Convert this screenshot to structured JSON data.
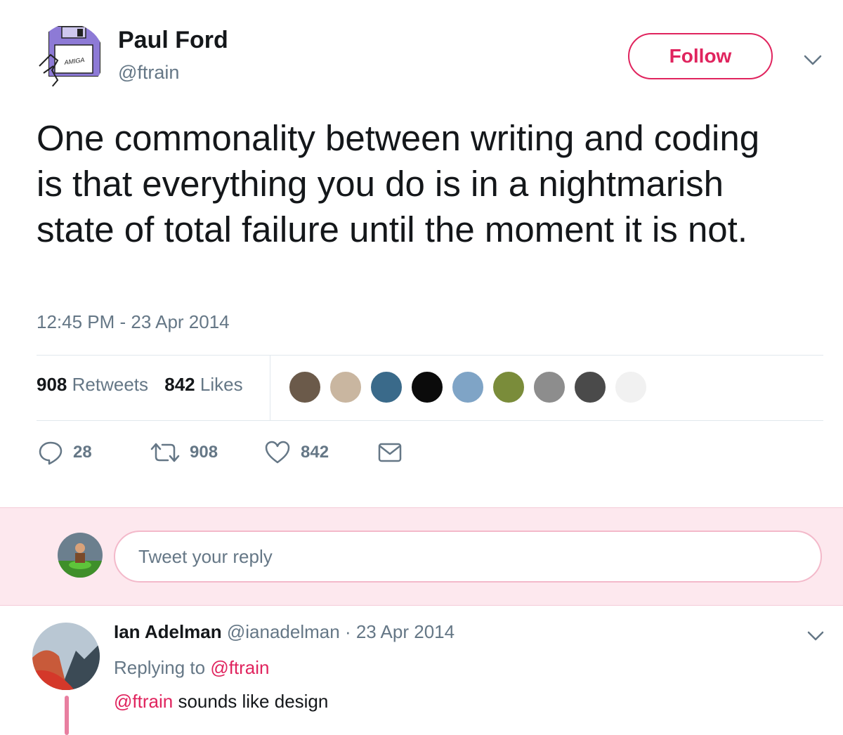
{
  "author": {
    "name": "Paul Ford",
    "handle": "@ftrain",
    "avatar_icon": "amiga-floppy-disk-icon",
    "avatar_text": "AMIGA"
  },
  "follow_label": "Follow",
  "tweet": {
    "text": "One commonality between writing and coding is that everything you do is in a nightmarish state of total failure until the moment it is not.",
    "timestamp": "12:45 PM - 23 Apr 2014"
  },
  "stats": {
    "retweets_count": "908",
    "retweets_label": "Retweets",
    "likes_count": "842",
    "likes_label": "Likes"
  },
  "facepile": [
    {
      "name": "face-1",
      "color": "#6b5a4a"
    },
    {
      "name": "face-2",
      "color": "#c9b6a0"
    },
    {
      "name": "face-3",
      "color": "#3a6a8a"
    },
    {
      "name": "face-4",
      "color": "#0b0b0b"
    },
    {
      "name": "face-5",
      "color": "#7fa4c6"
    },
    {
      "name": "face-6",
      "color": "#7a8c3a"
    },
    {
      "name": "face-7",
      "color": "#8d8d8d"
    },
    {
      "name": "face-8",
      "color": "#4a4a4a"
    },
    {
      "name": "face-9",
      "color": "#f1f1f1"
    }
  ],
  "actions": {
    "reply_count": "28",
    "retweet_count": "908",
    "like_count": "842"
  },
  "reply_box": {
    "placeholder": "Tweet your reply"
  },
  "reply": {
    "name": "Ian Adelman",
    "handle": "@ianadelman",
    "separator": "·",
    "date": "23 Apr 2014",
    "replying_prefix": "Replying to",
    "replying_handle": "@ftrain",
    "mention": "@ftrain",
    "text": "sounds like design"
  },
  "colors": {
    "accent": "#e0245e",
    "secondary_text": "#657786",
    "primary_text": "#14171a",
    "reply_band": "#fde8ee"
  }
}
